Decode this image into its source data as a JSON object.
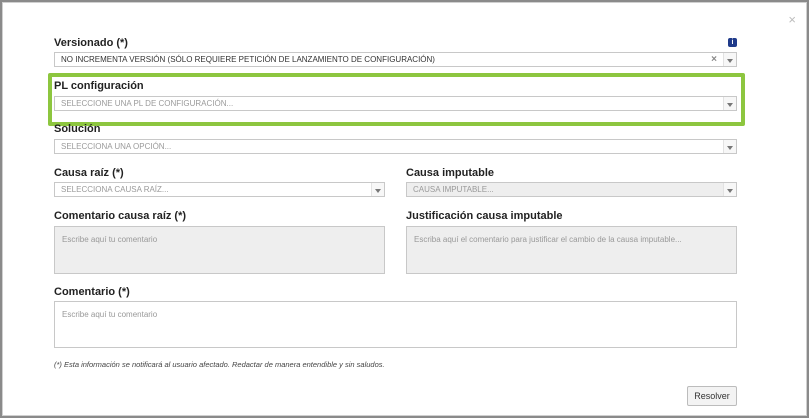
{
  "modal": {
    "close_glyph": "×",
    "info_glyph": "i"
  },
  "versionado": {
    "label": "Versionado (*)",
    "value": "NO INCREMENTA VERSIÓN (SÓLO REQUIERE PETICIÓN DE LANZAMIENTO DE CONFIGURACIÓN)",
    "clear_glyph": "×"
  },
  "pl_configuracion": {
    "label": "PL configuración",
    "placeholder": "SELECCIONE UNA PL DE CONFIGURACIÓN...",
    "highlight_color": "#8dc63f"
  },
  "solucion": {
    "label": "Solución",
    "placeholder": "SELECCIONA UNA OPCIÓN..."
  },
  "causa_raiz": {
    "label": "Causa raíz (*)",
    "placeholder": "SELECCIONA CAUSA RAÍZ..."
  },
  "causa_imputable": {
    "label": "Causa imputable",
    "placeholder": "CAUSA IMPUTABLE..."
  },
  "comentario_causa_raiz": {
    "label": "Comentario causa raíz (*)",
    "placeholder": "Escribe aquí tu comentario"
  },
  "justificacion": {
    "label": "Justificación causa imputable",
    "placeholder": "Escriba aquí el comentario para justificar el cambio de la causa imputable..."
  },
  "comentario": {
    "label": "Comentario (*)",
    "placeholder": "Escribe aquí tu comentario"
  },
  "footer": {
    "note": "(*) Esta información se notificará al usuario afectado. Redactar de manera entendible y sin saludos.",
    "resolve_label": "Resolver"
  }
}
